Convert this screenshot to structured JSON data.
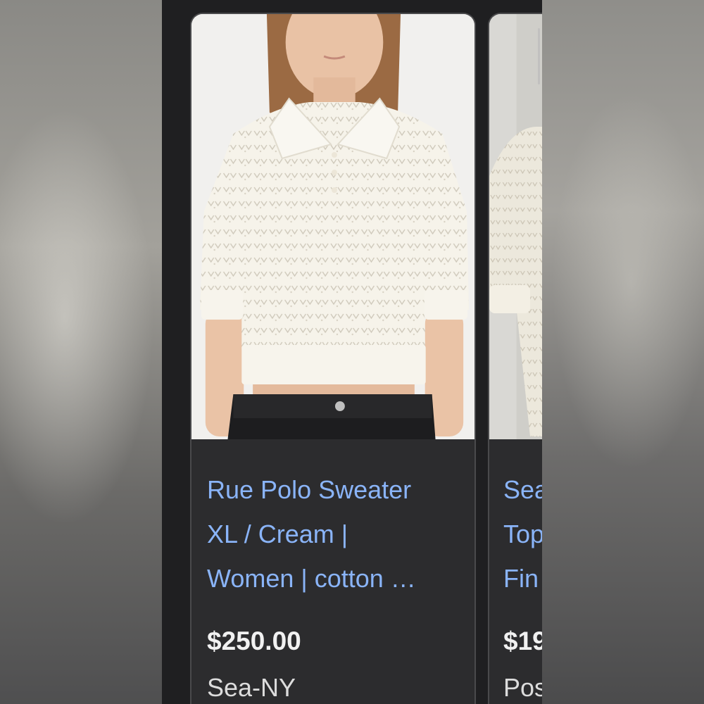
{
  "cards": [
    {
      "title_lines": [
        "Rue Polo Sweater",
        "XL / Cream |",
        "Women | cotton …"
      ],
      "price": "$250.00",
      "store": "Sea-NY",
      "image_alt": "cream pointelle knit polo sweater worn with black jeans"
    },
    {
      "title_lines": [
        "Sea",
        "Top",
        "Fin"
      ],
      "price": "$19",
      "store": "Pos",
      "image_alt": "cream knit sweater partial view"
    }
  ],
  "colors": {
    "link": "#8ab4f8",
    "card_bg": "#2c2c2e",
    "page_bg": "#1f1f21",
    "price": "#f1f1f1",
    "store": "#dcdcdc"
  }
}
